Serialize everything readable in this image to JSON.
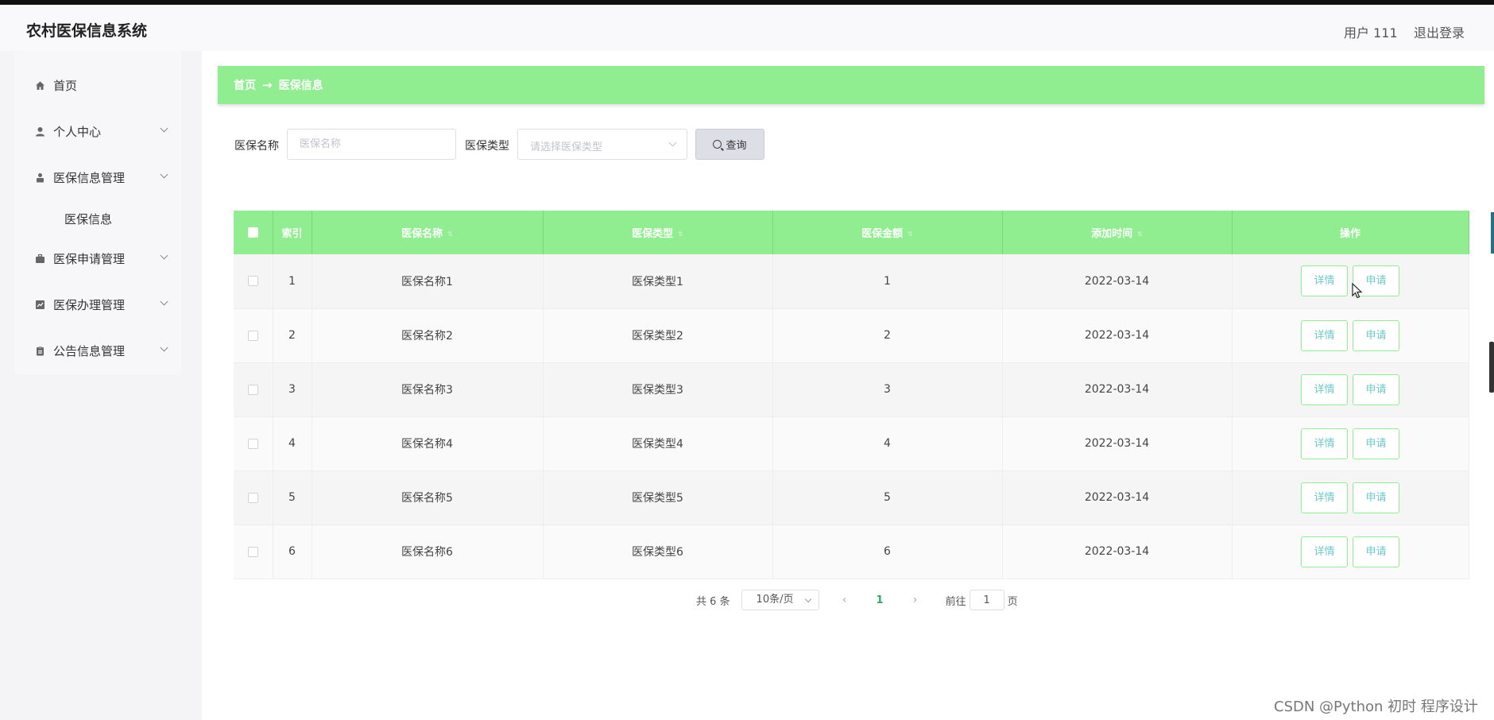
{
  "header": {
    "title": "农村医保信息系统",
    "user": "用户 111",
    "logout": "退出登录"
  },
  "sidebar": {
    "items": [
      {
        "label": "首页",
        "icon": "home-icon"
      },
      {
        "label": "个人中心",
        "icon": "user-icon"
      },
      {
        "label": "医保信息管理",
        "icon": "person-badge-icon"
      },
      {
        "label": "医保信息",
        "icon": ""
      },
      {
        "label": "医保申请管理",
        "icon": "briefcase-icon"
      },
      {
        "label": "医保办理管理",
        "icon": "chart-icon"
      },
      {
        "label": "公告信息管理",
        "icon": "clipboard-icon"
      }
    ]
  },
  "breadcrumb": {
    "home": "首页",
    "separator": "→",
    "current": "医保信息"
  },
  "search": {
    "name_label": "医保名称",
    "name_placeholder": "医保名称",
    "type_label": "医保类型",
    "type_placeholder": "请选择医保类型",
    "query_label": "查询"
  },
  "table": {
    "headers": [
      "索引",
      "医保名称",
      "医保类型",
      "医保金额",
      "添加时间",
      "操作"
    ],
    "rows": [
      {
        "index": "1",
        "name": "医保名称1",
        "type": "医保类型1",
        "amount": "1",
        "date": "2022-03-14"
      },
      {
        "index": "2",
        "name": "医保名称2",
        "type": "医保类型2",
        "amount": "2",
        "date": "2022-03-14"
      },
      {
        "index": "3",
        "name": "医保名称3",
        "type": "医保类型3",
        "amount": "3",
        "date": "2022-03-14"
      },
      {
        "index": "4",
        "name": "医保名称4",
        "type": "医保类型4",
        "amount": "4",
        "date": "2022-03-14"
      },
      {
        "index": "5",
        "name": "医保名称5",
        "type": "医保类型5",
        "amount": "5",
        "date": "2022-03-14"
      },
      {
        "index": "6",
        "name": "医保名称6",
        "type": "医保类型6",
        "amount": "6",
        "date": "2022-03-14"
      }
    ],
    "detail_label": "详情",
    "apply_label": "申请"
  },
  "pager": {
    "total": "共 6 条",
    "page_size": "10条/页",
    "current_page": "1",
    "goto_prefix": "前往",
    "goto_value": "1",
    "goto_suffix": "页"
  },
  "watermark": "CSDN @Python 初时 程序设计",
  "colors": {
    "accent": "#90ee90",
    "page_active": "#2da866",
    "button_text": "#6cc9c9"
  }
}
